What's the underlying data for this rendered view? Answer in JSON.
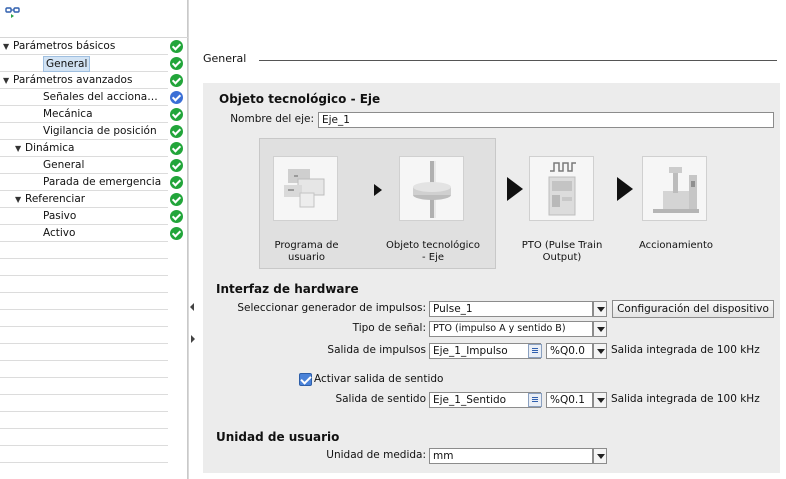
{
  "tree": {
    "items": [
      {
        "label": "Parámetros básicos",
        "level": 0,
        "expanded": true,
        "selected": false,
        "status": "ok"
      },
      {
        "label": "General",
        "level": 1,
        "expanded": null,
        "selected": true,
        "status": "ok"
      },
      {
        "label": "Parámetros avanzados",
        "level": 0,
        "expanded": true,
        "selected": false,
        "status": "ok"
      },
      {
        "label": "Señales del accionamie...",
        "level": 1,
        "expanded": null,
        "selected": false,
        "status": "info"
      },
      {
        "label": "Mecánica",
        "level": 1,
        "expanded": null,
        "selected": false,
        "status": "ok"
      },
      {
        "label": "Vigilancia de posición",
        "level": 1,
        "expanded": null,
        "selected": false,
        "status": "ok"
      },
      {
        "label": "Dinámica",
        "level": 1,
        "expanded": true,
        "selected": false,
        "status": "ok"
      },
      {
        "label": "General",
        "level": 2,
        "expanded": null,
        "selected": false,
        "status": "ok"
      },
      {
        "label": "Parada de emergencia",
        "level": 2,
        "expanded": null,
        "selected": false,
        "status": "ok"
      },
      {
        "label": "Referenciar",
        "level": 1,
        "expanded": true,
        "selected": false,
        "status": "ok"
      },
      {
        "label": "Pasivo",
        "level": 2,
        "expanded": null,
        "selected": false,
        "status": "ok"
      },
      {
        "label": "Activo",
        "level": 2,
        "expanded": null,
        "selected": false,
        "status": "ok"
      }
    ]
  },
  "section": {
    "title": "General"
  },
  "objeto": {
    "heading": "Objeto tecnológico - Eje",
    "axis_name_label": "Nombre del eje:",
    "axis_name_value": "Eje_1"
  },
  "diagram": {
    "captions": [
      "Programa de usuario",
      "Objeto tecnológico - Eje",
      "PTO (Pulse Train Output)",
      "Accionamiento"
    ]
  },
  "hardware": {
    "heading": "Interfaz de hardware",
    "generator_label": "Seleccionar generador de impulsos:",
    "generator_value": "Pulse_1",
    "device_config_button": "Configuración del dispositivo",
    "signal_type_label": "Tipo de señal:",
    "signal_type_value": "PTO (impulso A y sentido B)",
    "pulse_output_label": "Salida de impulsos",
    "pulse_output_value": "Eje_1_Impulso",
    "pulse_address": "%Q0.0",
    "pulse_note": "Salida integrada de 100 kHz",
    "enable_direction_label": "Activar salida de sentido",
    "enable_direction_checked": true,
    "direction_output_label": "Salida de sentido",
    "direction_output_value": "Eje_1_Sentido",
    "direction_address": "%Q0.1",
    "direction_note": "Salida integrada de 100 kHz"
  },
  "units": {
    "heading": "Unidad de usuario",
    "measure_label": "Unidad de medida:",
    "measure_value": "mm"
  },
  "colors": {
    "status_ok": "#22a53a",
    "status_info": "#3b6fd6",
    "selection": "#d2e3f4",
    "panel": "#ececec"
  }
}
